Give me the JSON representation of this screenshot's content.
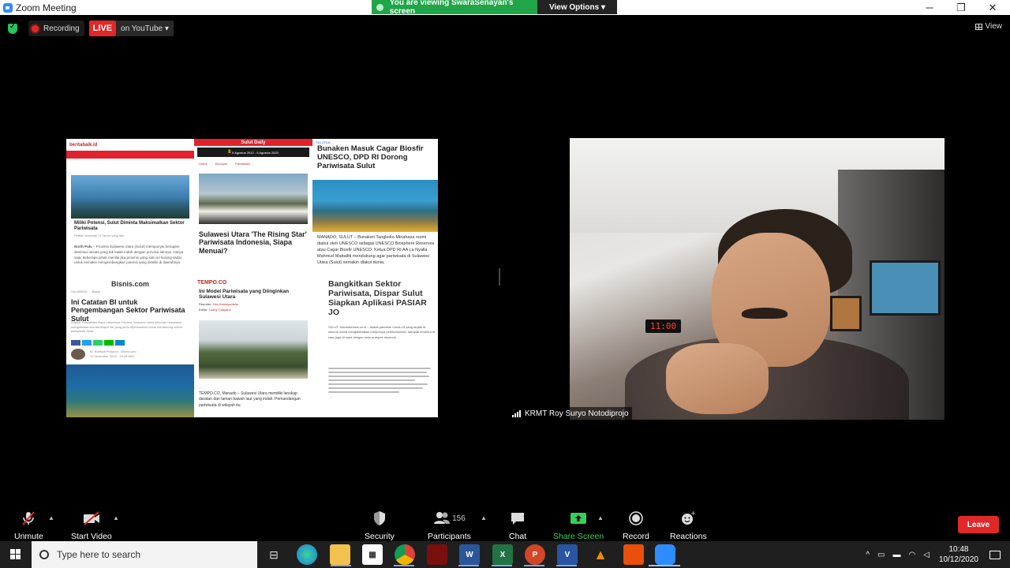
{
  "window": {
    "title": "Zoom Meeting",
    "controls": {
      "minimize": "─",
      "maximize": "❐",
      "close": "✕"
    }
  },
  "share_banner": {
    "text": "You are viewing SwaraSenayan's screen",
    "view_options": "View Options ▾"
  },
  "status": {
    "recording_label": "Recording",
    "live_label": "LIVE",
    "youtube_label": "on YouTube ▾"
  },
  "view_button": "View",
  "shared_screen": {
    "articles": [
      {
        "site": "beritabaik.id",
        "headline": "Miliki Potensi, Sulut Diminta Maksimalkan Sektor Pariwisata",
        "byline": "Pettian Nurmala | 2 Tahun yang lalu",
        "lead": "North Palu",
        "excerpt": "– Provinsi Sulawesi Utara (Sulut) mempunyai beragam destinasi wisata yang tak kalah indah dengan provinsi lainnya. Hanya saja, beberapa pihak menilai jika provinsi yang satu ini kurang sadar untuk semakin mengembangkan potensi yang dimiliki di daerahnya."
      },
      {
        "site": "Sulut Daily",
        "banner_top": "8",
        "banner_dates": "5 Agustus 2012 - 5 Agustus 2020",
        "crumbs": [
          "Home",
          "Ekonomi",
          "Pariwisata"
        ],
        "headline": "Sulawesi Utara 'The Rising Star' Pariwisata Indonesia, Siapa Menuai?"
      },
      {
        "site": "SULUTDA",
        "headline": "Bunaken Masuk Cagar Biosfir UNESCO, DPD RI Dorong Pariwisata Sulut",
        "excerpt": "MANADO, SULUT – Bunaken Tangkoko Minahasa resmi diakui oleh UNESCO sebagai UNESCO Biosphere Reserves atau Cagar Biosfir UNESCO. Ketua DPD RI AA La Nyalla Mahmud Mattalitti mendukung agar pariwisata di Sulawesi Utara (Sulut) semakin diakui dunia."
      },
      {
        "site": "Bisnis.com",
        "crumbs": [
          "SULAWESI",
          "Bisnis"
        ],
        "headline": "Ini Catatan BI untuk Pengembangan Sektor Pariwisata Sulut",
        "excerpt": "Kepala Perwakilan Bank Indonesia Provinsi Sulawesi Utara Arbonas Hutabarat mengatakan ada beberapa hal yang perlu diperhatikan untuk mendorong sektor pariwisata Sulut.",
        "author": "M. Nurhadi Pratomo - Bisnis.com",
        "date": "11 Desember 2019 - 19:26 WIB"
      },
      {
        "site": "TEMPO.CO",
        "headline": "Ini Model Pariwisata yang Diinginkan Sulawesi Utara",
        "reporter_label": "Reporter:",
        "reporter": "Nini Kamiryanishu",
        "editor_label": "Editor:",
        "editor": "Ludhy Cahyana",
        "lead": "TEMPO.CO, Manado",
        "excerpt": "– Sulawesi Utara memiliki lanskap daratan dan taman bawah laut yang indah. Pemandangan pariwisata di wilayah itu."
      },
      {
        "headline": "Bangkitkan Sektor Pariwisata, Dispar Sulut Siapkan Aplikasi PASIAR JO",
        "excerpt": "SULUT. Manadonews.co.id – Akibat pandemi Covid-19 yang terjadi di seluruh dunia mengakibatkan tumpurnya perekonomian, dampak tersebut ia rasa juga di sulut dengan semua aspek ekonomi."
      }
    ]
  },
  "video": {
    "participant_name": "KRMT Roy Suryo Notodiprojo",
    "clock_display": "11:00"
  },
  "toolbar": {
    "unmute": "Unmute",
    "start_video": "Start Video",
    "security": "Security",
    "participants": "Participants",
    "participants_count": "156",
    "chat": "Chat",
    "share_screen": "Share Screen",
    "record": "Record",
    "reactions": "Reactions",
    "leave": "Leave"
  },
  "taskbar": {
    "search_placeholder": "Type here to search",
    "time": "10:48",
    "date": "10/12/2020"
  },
  "colors": {
    "accent_green": "#20a548",
    "live_red": "#e02828",
    "leave_red": "#e02828",
    "share_green": "#34d058"
  }
}
